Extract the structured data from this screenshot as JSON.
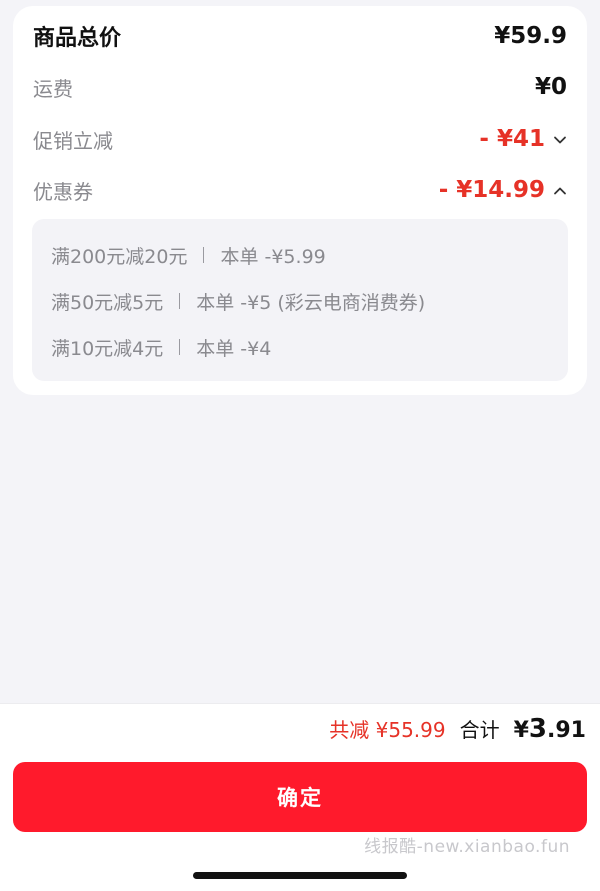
{
  "summary_card": {
    "total_label": "商品总价",
    "total_amount": "¥59.9",
    "shipping_label": "运费",
    "shipping_amount": "¥0",
    "promo_label": "促销立减",
    "promo_amount": "- ¥41",
    "coupon_label": "优惠券",
    "coupon_amount": "- ¥14.99"
  },
  "coupons": [
    {
      "rule": "满200元减20元",
      "detail": "本单 -¥5.99"
    },
    {
      "rule": "满50元减5元",
      "detail": "本单 -¥5 (彩云电商消费券)"
    },
    {
      "rule": "满10元减4元",
      "detail": "本单 -¥4"
    }
  ],
  "footer": {
    "saved_text": "共减 ¥55.99",
    "total_label": "合计",
    "total_currency": "¥",
    "total_int": "3",
    "total_dec": ".91",
    "confirm_label": "确定",
    "watermark": "线报酷-new.xianbao.fun"
  },
  "colors": {
    "accent_red": "#e63227",
    "button_red": "#ff1a2c",
    "background": "#f4f4f8"
  }
}
